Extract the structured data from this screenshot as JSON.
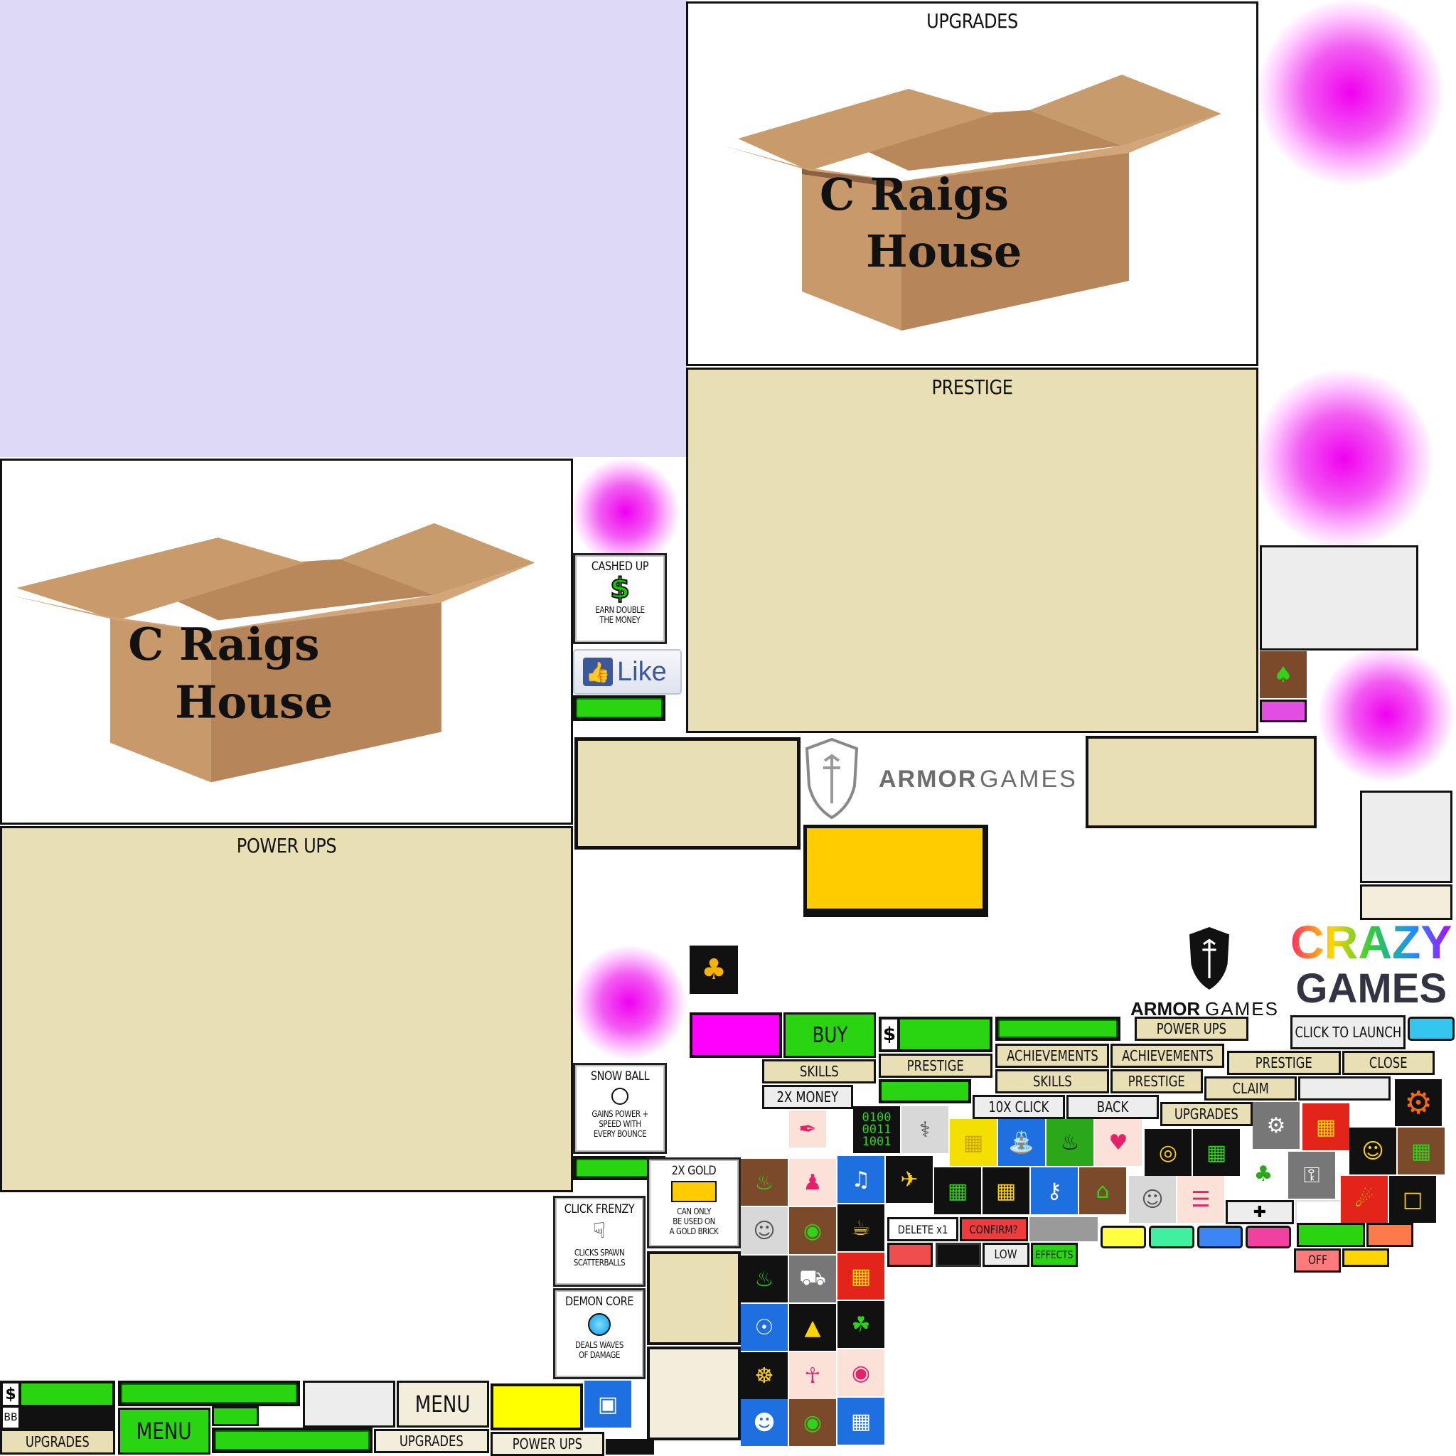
{
  "panels": {
    "upgrades_title": "UPGRADES",
    "prestige_title": "PRESTIGE",
    "power_ups_title": "POWER UPS"
  },
  "box_art": {
    "line1": "C Raigs",
    "line2": "House"
  },
  "cards": {
    "cashed_up": {
      "title": "CASHED UP",
      "icon": "dollar-icon",
      "desc1": "EARN DOUBLE",
      "desc2": "THE MONEY"
    },
    "snow_ball": {
      "title": "SNOW BALL",
      "icon": "circle-icon",
      "desc1": "GAINS POWER +",
      "desc2": "SPEED WITH",
      "desc3": "EVERY BOUNCE"
    },
    "click_frenzy": {
      "title": "CLICK FRENZY",
      "icon": "pointer-icon",
      "desc1": "CLICKS SPAWN",
      "desc2": "SCATTERBALLS"
    },
    "demon_core": {
      "title": "DEMON CORE",
      "icon": "blue-orb-icon",
      "desc1": "DEALS WAVES",
      "desc2": "OF DAMAGE"
    },
    "two_x_gold": {
      "title": "2X GOLD",
      "icon": "gold-brick-icon",
      "desc1": "CAN ONLY",
      "desc2": "BE USED ON",
      "desc3": "A GOLD BRICK"
    }
  },
  "like_button": {
    "label": "Like"
  },
  "logos": {
    "armor_games_word1": "ARMOR",
    "armor_games_word2": "GAMES",
    "crazy": "CRAZY",
    "games": "GAMES"
  },
  "buttons": {
    "buy": "BUY",
    "skills_1": "SKILLS",
    "two_x_money": "2X MONEY",
    "prestige_1": "PRESTIGE",
    "achievements_1": "ACHIEVEMENTS",
    "achievements_2": "ACHIEVEMENTS",
    "power_ups": "POWER UPS",
    "click_to_launch": "CLICK TO LAUNCH",
    "skills_2": "SKILLS",
    "prestige_2": "PRESTIGE",
    "prestige_3": "PRESTIGE",
    "close": "CLOSE",
    "claim": "CLAIM",
    "ten_x_click": "10X CLICK",
    "back": "BACK",
    "upgrades_small": "UPGRADES",
    "delete": "DELETE x1",
    "confirm": "CONFIRM?",
    "low": "LOW",
    "effects": "EFFECTS",
    "off": "OFF",
    "menu_1": "MENU",
    "menu_2": "MENU",
    "upgrades_bottom_1": "UPGRADES",
    "upgrades_bottom_2": "UPGRADES",
    "power_ups_bottom": "POWER UPS"
  },
  "hud": {
    "dollar": "$",
    "bb": "BB",
    "dollar_2": "$"
  },
  "binary": {
    "l1": "0100",
    "l2": "0011",
    "l3": "1001"
  },
  "colors": {
    "beige": "#e8dfb5",
    "green": "#29d410",
    "magenta": "#ff00ff",
    "gold": "#ffcc00",
    "lavender": "#dedaf6"
  }
}
